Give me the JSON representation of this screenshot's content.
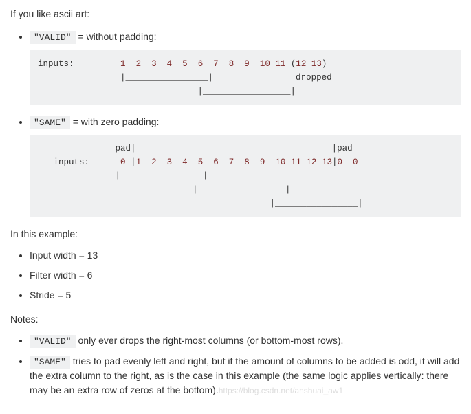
{
  "intro": "If you like ascii art:",
  "bullet1_prefix": " = without padding:",
  "bullet1_code": "\"VALID\"",
  "codeblock1": "inputs:         1  2  3  4  5  6  7  8  9  10 11 (12 13)\n                |________________|                dropped\n                               |_________________|",
  "bullet2_prefix": " = with zero padding:",
  "bullet2_code": "\"SAME\"",
  "codeblock2": "               pad|                                      |pad\n   inputs:      0 |1  2  3  4  5  6  7  8  9  10 11 12 13|0  0\n               |________________|\n                              |_________________|\n                                              |________________|",
  "example_heading": "In this example:",
  "example_items": [
    "Input width = 13",
    "Filter width = 6",
    "Stride = 5"
  ],
  "notes_heading": "Notes:",
  "note1_code": "\"VALID\"",
  "note1_text": " only ever drops the right-most columns (or bottom-most rows).",
  "note2_code": "\"SAME\"",
  "note2_text": " tries to pad evenly left and right, but if the amount of columns to be added is odd, it will add the extra column to the right, as is the case in this example (the same logic applies vertically: there may be an extra row of zeros at the bottom).",
  "watermark": "https://blog.csdn.net/anshuai_aw1"
}
